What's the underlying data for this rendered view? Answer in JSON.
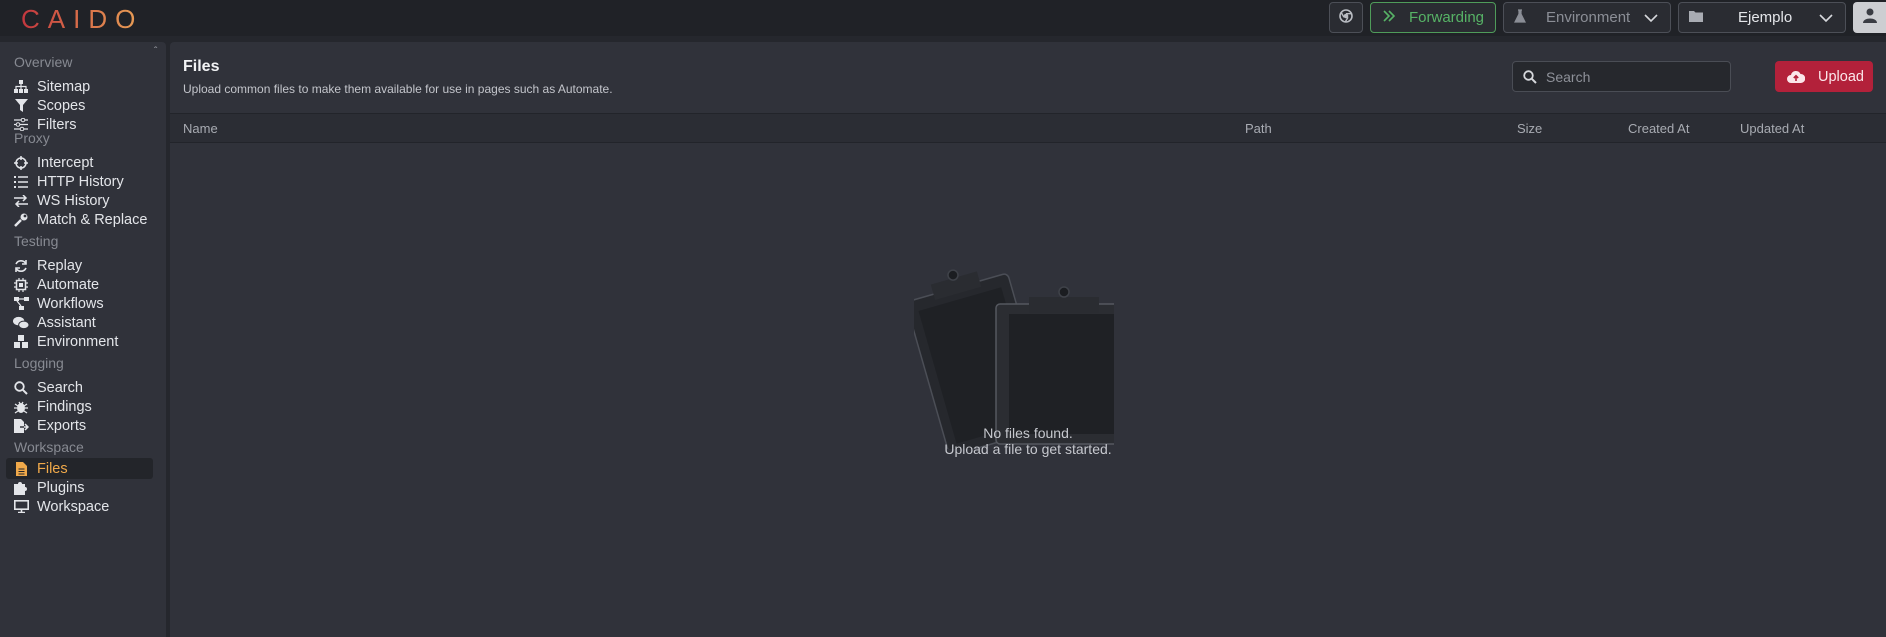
{
  "app": {
    "logo": "CAIDO"
  },
  "topbar": {
    "forwarding_label": "Forwarding",
    "environment_label": "Environment",
    "workspace_label": "Ejemplo"
  },
  "sidebar": {
    "sections": [
      {
        "title": "Overview",
        "items": [
          {
            "label": "Sitemap",
            "icon": "sitemap-icon"
          },
          {
            "label": "Scopes",
            "icon": "filter-icon"
          },
          {
            "label": "Filters",
            "icon": "sliders-icon"
          }
        ]
      },
      {
        "title": "Proxy",
        "items": [
          {
            "label": "Intercept",
            "icon": "crosshair-icon"
          },
          {
            "label": "HTTP History",
            "icon": "list-icon"
          },
          {
            "label": "WS History",
            "icon": "arrows-icon"
          },
          {
            "label": "Match & Replace",
            "icon": "wrench-icon"
          }
        ]
      },
      {
        "title": "Testing",
        "items": [
          {
            "label": "Replay",
            "icon": "refresh-icon"
          },
          {
            "label": "Automate",
            "icon": "chip-icon"
          },
          {
            "label": "Workflows",
            "icon": "workflow-icon"
          },
          {
            "label": "Assistant",
            "icon": "chat-icon"
          },
          {
            "label": "Environment",
            "icon": "cubes-icon"
          }
        ]
      },
      {
        "title": "Logging",
        "items": [
          {
            "label": "Search",
            "icon": "search-icon"
          },
          {
            "label": "Findings",
            "icon": "bug-icon"
          },
          {
            "label": "Exports",
            "icon": "export-icon"
          }
        ]
      },
      {
        "title": "Workspace",
        "items": [
          {
            "label": "Files",
            "icon": "file-icon",
            "active": true
          },
          {
            "label": "Plugins",
            "icon": "puzzle-icon"
          },
          {
            "label": "Workspace",
            "icon": "monitor-icon"
          }
        ]
      }
    ]
  },
  "main": {
    "title": "Files",
    "subtitle": "Upload common files to make them available for use in pages such as Automate.",
    "search_placeholder": "Search",
    "upload_label": "Upload",
    "columns": [
      "Name",
      "Path",
      "Size",
      "Created At",
      "Updated At"
    ],
    "empty_title": "No files found.",
    "empty_hint": "Upload a file to get started."
  },
  "colors": {
    "accent": "#f0a94a",
    "forwarding": "#57b366",
    "upload": "#b3213a"
  }
}
